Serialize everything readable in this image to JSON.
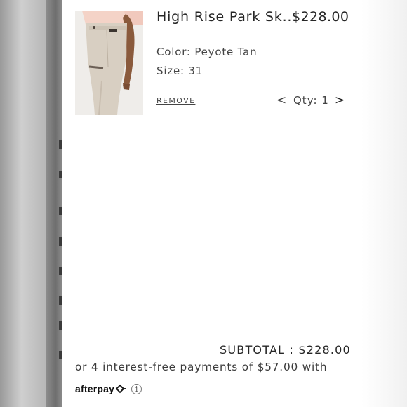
{
  "cart_item": {
    "title": "High Rise Park Sk...",
    "price": "$228.00",
    "color": "Color: Peyote Tan",
    "size": "Size: 31",
    "remove_label": "REMOVE",
    "qty_prev": "<",
    "qty_label": "Qty: 1",
    "qty_next": ">"
  },
  "summary": {
    "subtotal_text": "SUBTOTAL  :  $228.00",
    "installments_text": "or 4 interest-free payments of $57.00 with",
    "afterpay_brand": "afterpay",
    "info_glyph": "i"
  },
  "icons": {
    "afterpay_mark": "afterpay-loop-icon",
    "info": "info-icon"
  }
}
